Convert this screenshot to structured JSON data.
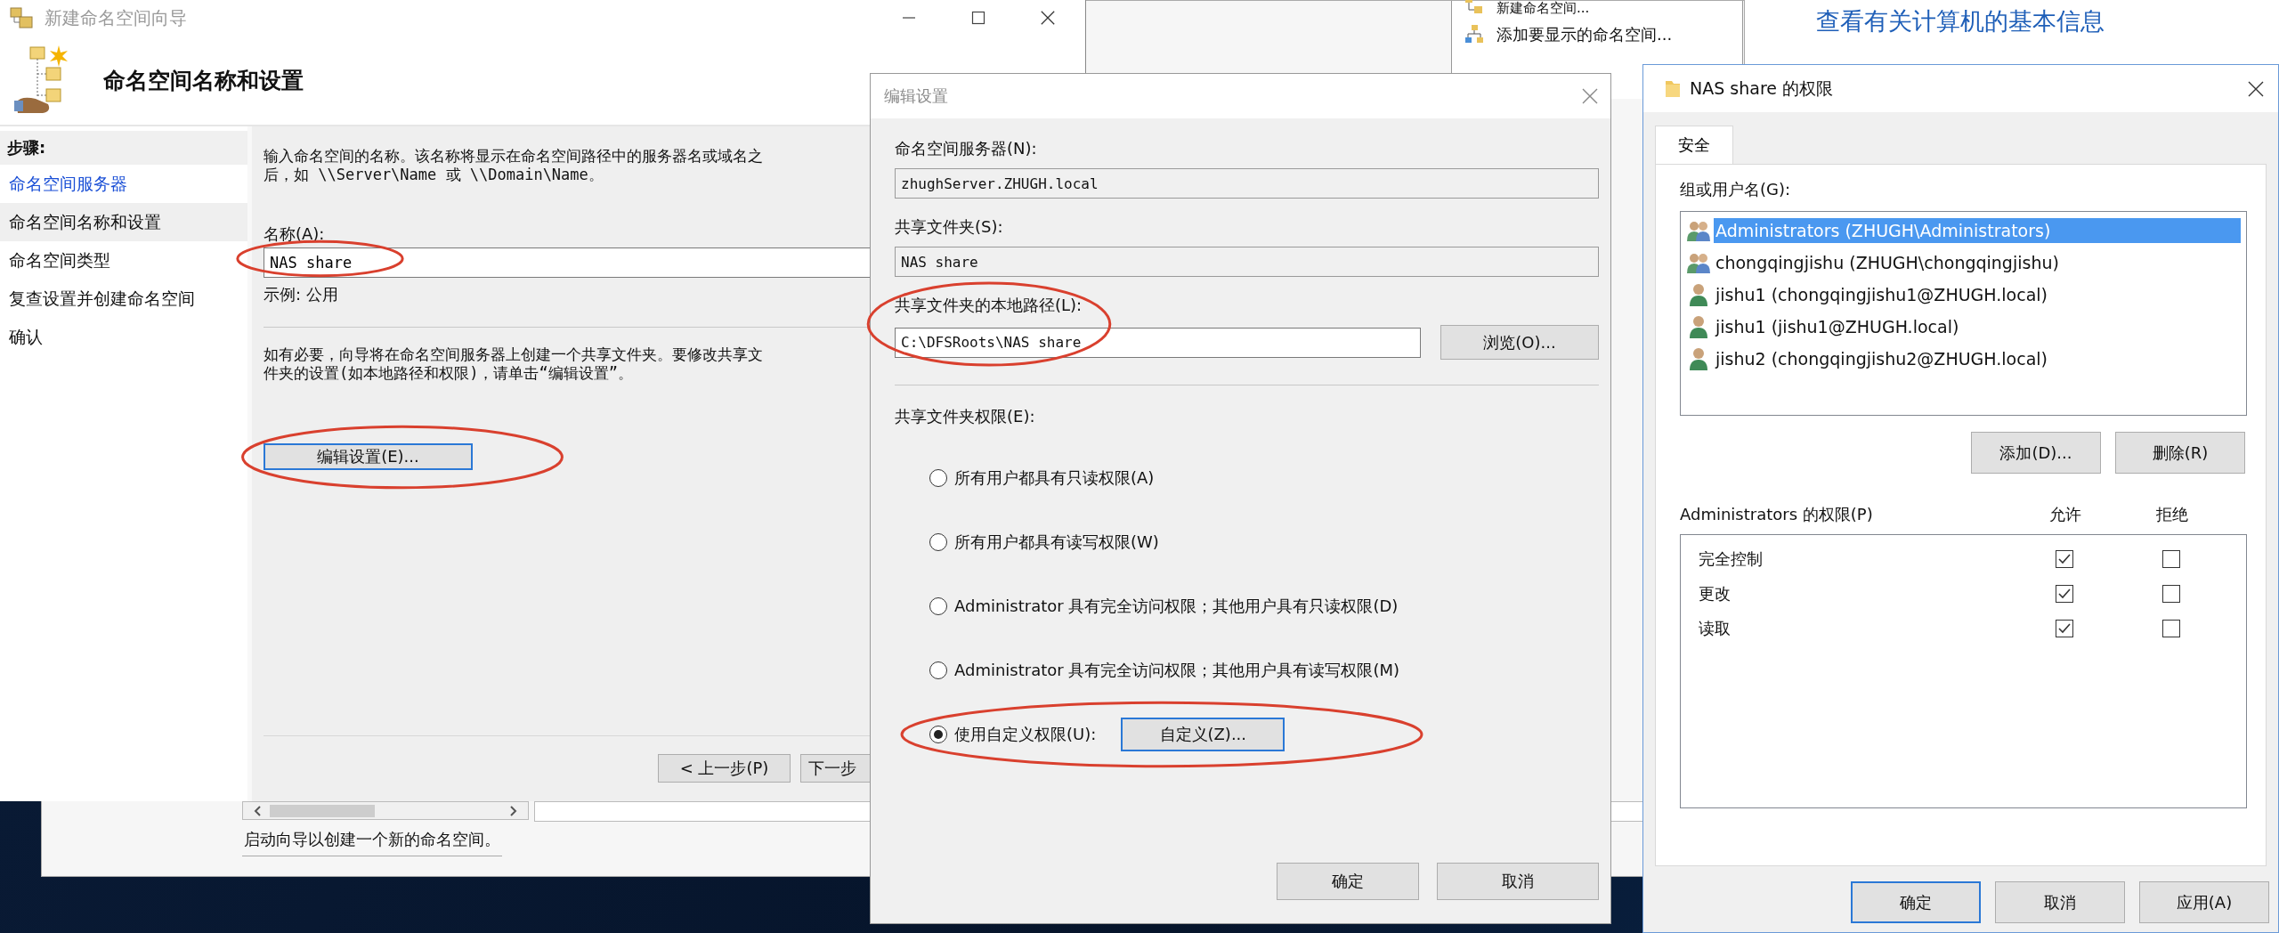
{
  "mmc_window": {
    "actions": [
      {
        "label": "新建命名空间...",
        "kind": "new"
      },
      {
        "label": "添加要显示的命名空间...",
        "kind": "add"
      }
    ],
    "status_bar": "启动向导以创建一个新的命名空间。"
  },
  "system_window": {
    "heading": "查看有关计算机的基本信息"
  },
  "wizard": {
    "title": "新建命名空间向导",
    "heading": "命名空间名称和设置",
    "steps_label": "步骤:",
    "steps": [
      {
        "label": "命名空间服务器",
        "kind": "link",
        "selected": false
      },
      {
        "label": "命名空间名称和设置",
        "kind": "text",
        "selected": true
      },
      {
        "label": "命名空间类型",
        "kind": "text",
        "selected": false
      },
      {
        "label": "复查设置并创建命名空间",
        "kind": "text",
        "selected": false
      },
      {
        "label": "确认",
        "kind": "text",
        "selected": false
      }
    ],
    "intro_lines": [
      "输入命名空间的名称。该名称将显示在命名空间路径中的服务器名或域名之",
      "后，如 \\\\Server\\Name 或 \\\\Domain\\Name。"
    ],
    "name_field": {
      "label": "名称(A):",
      "value": "NAS share",
      "circled": true
    },
    "example": "示例: 公用",
    "note_lines": [
      "如有必要，向导将在命名空间服务器上创建一个共享文件夹。要修改共享文",
      "件夹的设置(如本地路径和权限)，请单击“编辑设置”。"
    ],
    "edit_button": {
      "label": "编辑设置(E)...",
      "focused": true,
      "circled": true
    },
    "buttons": [
      {
        "label": "< 上一步(P)",
        "focused": false
      },
      {
        "label": "下一步",
        "focused": false
      }
    ]
  },
  "edit_dialog": {
    "title": "编辑设置",
    "fields": [
      {
        "label": "命名空间服务器(N):",
        "value": "zhughServer.ZHUGH.local",
        "readonly": true,
        "circled": false
      },
      {
        "label": "共享文件夹(S):",
        "value": "NAS share",
        "readonly": true,
        "circled": false
      },
      {
        "label": "共享文件夹的本地路径(L):",
        "value": "C:\\DFSRoots\\NAS share",
        "readonly": false,
        "button": "浏览(O)...",
        "circled": true
      }
    ],
    "permissions_label": "共享文件夹权限(E):",
    "options": [
      {
        "label": "所有用户都具有只读权限(A)",
        "selected": false,
        "circled": false
      },
      {
        "label": "所有用户都具有读写权限(W)",
        "selected": false,
        "circled": false
      },
      {
        "label": "Administrator 具有完全访问权限；其他用户具有只读权限(D)",
        "selected": false,
        "circled": false
      },
      {
        "label": "Administrator 具有完全访问权限；其他用户具有读写权限(M)",
        "selected": false,
        "circled": false
      },
      {
        "label": "使用自定义权限(U):",
        "selected": true,
        "button": {
          "label": "自定义(Z)...",
          "focused": true
        },
        "circled": true
      }
    ],
    "buttons": [
      {
        "label": "确定",
        "focused": false
      },
      {
        "label": "取消",
        "focused": false
      }
    ]
  },
  "permissions_dialog": {
    "title": "NAS share 的权限",
    "tabs": [
      {
        "label": "安全",
        "selected": true
      }
    ],
    "users_label": "组或用户名(G):",
    "users": [
      {
        "name": "Administrators (ZHUGH\\Administrators)",
        "kind": "group",
        "selected": true
      },
      {
        "name": "chongqingjishu (ZHUGH\\chongqingjishu)",
        "kind": "group",
        "selected": false
      },
      {
        "name": "jishu1 (chongqingjishu1@ZHUGH.local)",
        "kind": "user",
        "selected": false
      },
      {
        "name": "jishu1 (jishu1@ZHUGH.local)",
        "kind": "user",
        "selected": false
      },
      {
        "name": "jishu2 (chongqingjishu2@ZHUGH.local)",
        "kind": "user",
        "selected": false
      }
    ],
    "user_buttons": [
      "添加(D)...",
      "删除(R)"
    ],
    "permissions_label": "Administrators 的权限(P)",
    "allow_label": "允许",
    "deny_label": "拒绝",
    "permissions": [
      {
        "name": "完全控制",
        "allow": true,
        "deny": false
      },
      {
        "name": "更改",
        "allow": true,
        "deny": false
      },
      {
        "name": "读取",
        "allow": true,
        "deny": false
      }
    ],
    "buttons": [
      {
        "label": "确定",
        "focused": true
      },
      {
        "label": "取消",
        "focused": false
      },
      {
        "label": "应用(A)",
        "focused": false
      }
    ]
  }
}
